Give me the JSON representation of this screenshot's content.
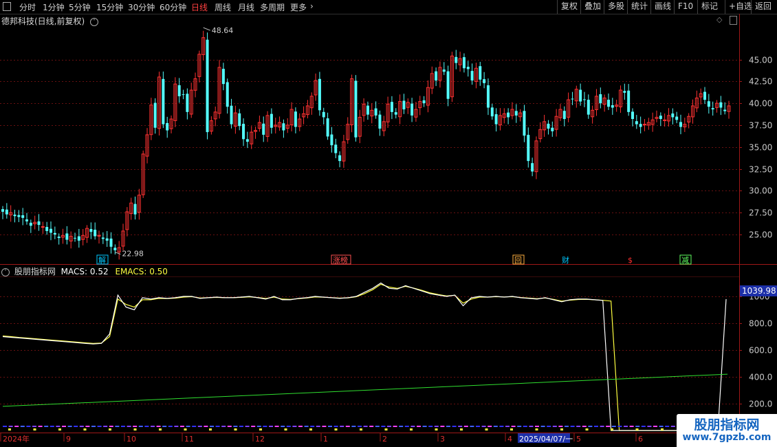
{
  "toolbar": {
    "timeframes": [
      "分时",
      "1分钟",
      "5分钟",
      "15分钟",
      "30分钟",
      "60分钟",
      "日线",
      "周线",
      "月线",
      "多周期",
      "更多"
    ],
    "active_timeframe": "日线",
    "more_icon": "chevron-right-icon",
    "right_buttons": [
      "复权",
      "叠加",
      "多股",
      "统计",
      "画线",
      "F10",
      "标记",
      "+自选",
      "返回"
    ]
  },
  "main_panel": {
    "title": "德邦科技(日线,前复权)",
    "settings_icon": "chevron-down-circle-icon",
    "right_icons": [
      "diamond-icon",
      "scrollbar-icon"
    ],
    "max_price_label": "48.64",
    "min_price_label": "22.98",
    "event_markers": [
      {
        "label": "解",
        "color": "#00c8ff",
        "box": true
      },
      {
        "label": "涨榜",
        "color": "#ff5050",
        "box": true
      },
      {
        "label": "回",
        "color": "#ffb040",
        "box": true
      },
      {
        "label": "财",
        "color": "#00c8ff",
        "box": false
      },
      {
        "label": "$",
        "color": "#ff3030",
        "box": false
      },
      {
        "label": "减",
        "color": "#60ff60",
        "box": true
      }
    ]
  },
  "indicator_panel": {
    "name": "股朋指标网",
    "macs_label": "MACS: 0.52",
    "emacs_label": "EMACS: 0.50",
    "current_value": "1039.98",
    "settings_icon": "chevron-down-circle-icon"
  },
  "date_axis": {
    "labels": [
      "2024年",
      "9",
      "10",
      "11",
      "12",
      "1",
      "2",
      "3",
      "4",
      "2025/04/07/一",
      "5",
      "6"
    ]
  },
  "watermark": {
    "title": "股朋指标网",
    "url": "www.7gpzb.com"
  },
  "colors": {
    "up": "#ff3232",
    "down": "#54ffff",
    "macs": "#ffffff",
    "emacs": "#ffff40",
    "trend": "#30e030",
    "grid": "#6a1010",
    "axis": "#a01818"
  },
  "chart_data": [
    {
      "type": "candlestick",
      "title": "德邦科技(日线,前复权)",
      "ylim": [
        22.5,
        47.8
      ],
      "y_ticks": [
        25.0,
        27.5,
        30.0,
        32.5,
        35.0,
        37.5,
        40.0,
        42.5,
        45.0
      ],
      "y_tick_labels": [
        "25.00",
        "27.50",
        "30.00",
        "32.50",
        "35.00",
        "37.50",
        "40.00",
        "42.50",
        "45.00"
      ],
      "annotations": [
        {
          "text": "48.64",
          "value": 48.64
        },
        {
          "text": "22.98",
          "value": 22.98
        }
      ],
      "closes": [
        27.6,
        27.3,
        27.5,
        27.1,
        27.0,
        26.9,
        26.5,
        26.0,
        26.4,
        26.1,
        25.9,
        25.4,
        25.2,
        25.0,
        24.6,
        24.9,
        24.4,
        24.8,
        24.6,
        24.3,
        24.9,
        25.7,
        25.3,
        24.8,
        24.9,
        24.5,
        24.3,
        23.6,
        23.2,
        23.5,
        25.4,
        27.6,
        28.6,
        27.3,
        29.5,
        34.2,
        36.4,
        39.8,
        37.2,
        43.0,
        37.6,
        36.9,
        38.2,
        42.2,
        40.8,
        41.0,
        39.0,
        41.5,
        42.8,
        45.6,
        47.5,
        36.7,
        38.0,
        39.0,
        44.1,
        42.2,
        39.6,
        37.6,
        38.9,
        37.4,
        35.9,
        35.6,
        36.7,
        36.9,
        37.8,
        36.4,
        38.6,
        37.2,
        37.5,
        37.8,
        36.9,
        37.5,
        39.3,
        37.3,
        38.2,
        38.8,
        39.7,
        40.8,
        42.6,
        39.2,
        38.4,
        36.2,
        35.2,
        34.3,
        33.4,
        35.6,
        37.6,
        42.8,
        36.1,
        38.4,
        39.9,
        38.7,
        39.2,
        38.6,
        37.1,
        37.9,
        39.9,
        39.0,
        38.7,
        40.2,
        39.3,
        40.1,
        38.6,
        39.3,
        40.2,
        40.0,
        41.8,
        43.4,
        42.6,
        44.1,
        43.6,
        40.5,
        45.4,
        44.6,
        45.1,
        44.0,
        43.9,
        42.6,
        44.0,
        42.7,
        42.3,
        39.5,
        38.5,
        37.6,
        38.6,
        38.8,
        38.4,
        39.3,
        38.6,
        38.9,
        36.3,
        33.4,
        32.2,
        35.7,
        37.0,
        37.9,
        37.1,
        36.8,
        38.5,
        39.3,
        38.2,
        40.4,
        40.5,
        41.6,
        40.2,
        40.4,
        38.7,
        39.2,
        40.8,
        40.0,
        40.6,
        39.6,
        39.5,
        39.8,
        41.5,
        41.2,
        39.0,
        38.2,
        37.6,
        37.3,
        37.6,
        37.8,
        38.1,
        38.4,
        38.2,
        38.1,
        38.6,
        38.4,
        38.1,
        37.3,
        37.6,
        38.5,
        39.7,
        40.6,
        41.1,
        40.4,
        39.6,
        39.3,
        40.0,
        39.5,
        39.1,
        39.7
      ]
    },
    {
      "type": "line",
      "title": "股朋指标网",
      "ylim": [
        0,
        1100
      ],
      "y_ticks": [
        200,
        400,
        600,
        800,
        1000
      ],
      "y_tick_labels": [
        "200.0",
        "400.0",
        "600.0",
        "800.0",
        "1000"
      ],
      "series": [
        {
          "name": "MACS",
          "values": [
            700,
            695,
            690,
            685,
            680,
            675,
            670,
            665,
            660,
            655,
            650,
            645,
            650,
            720,
            1010,
            920,
            900,
            990,
            980,
            990,
            985,
            990,
            1000,
            1000,
            985,
            990,
            995,
            990,
            990,
            995,
            1000,
            990,
            980,
            1000,
            975,
            975,
            985,
            990,
            1000,
            995,
            990,
            985,
            990,
            1000,
            1030,
            1060,
            1100,
            1060,
            1055,
            1080,
            1060,
            1040,
            1020,
            1010,
            1000,
            1010,
            930,
            990,
            1000,
            995,
            1000,
            995,
            1000,
            990,
            985,
            980,
            990,
            975,
            960,
            975,
            980,
            980,
            975,
            970,
            0,
            0,
            0,
            0,
            0,
            0,
            0,
            0,
            0,
            0,
            0,
            0,
            0,
            0,
            980
          ]
        },
        {
          "name": "EMACS",
          "values": [
            705,
            700,
            694,
            689,
            684,
            679,
            674,
            669,
            664,
            659,
            654,
            650,
            652,
            700,
            980,
            940,
            920,
            975,
            975,
            985,
            984,
            987,
            995,
            998,
            988,
            990,
            993,
            990,
            990,
            993,
            997,
            992,
            984,
            995,
            980,
            978,
            983,
            988,
            996,
            994,
            991,
            987,
            989,
            997,
            1020,
            1050,
            1090,
            1070,
            1060,
            1075,
            1062,
            1045,
            1026,
            1014,
            1003,
            1008,
            950,
            980,
            995,
            995,
            998,
            996,
            998,
            992,
            987,
            983,
            988,
            978,
            965,
            972,
            977,
            978,
            975,
            971,
            965,
            0,
            0,
            0,
            0,
            0,
            0,
            0,
            0,
            0,
            0,
            0,
            0,
            0,
            0,
            0
          ]
        }
      ],
      "trend_line": {
        "start": 180,
        "end": 420
      }
    }
  ]
}
